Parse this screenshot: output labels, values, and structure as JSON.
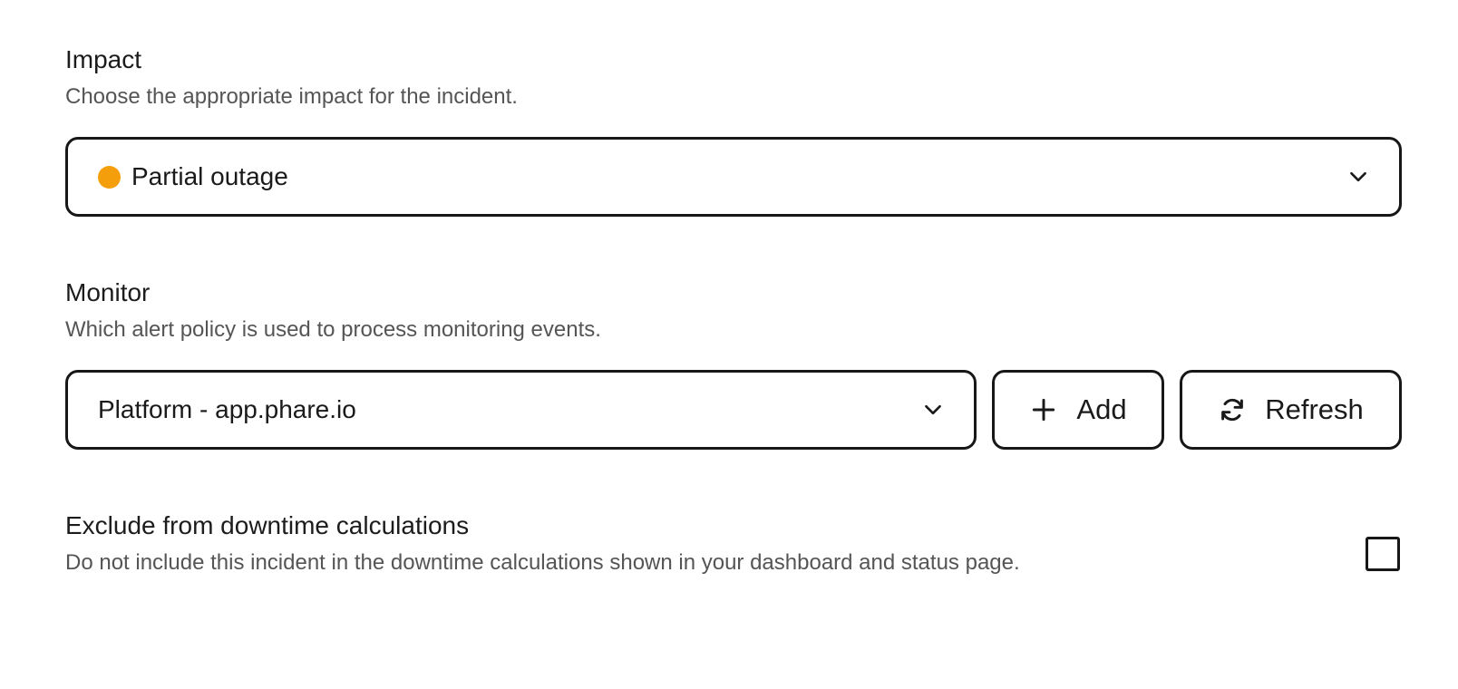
{
  "impact": {
    "title": "Impact",
    "description": "Choose the appropriate impact for the incident.",
    "selected_value": "Partial outage",
    "status_color": "#F59E0B",
    "chevron_icon": "chevron-down-icon"
  },
  "monitor": {
    "title": "Monitor",
    "description": "Which alert policy is used to process monitoring events.",
    "selected_value": "Platform - app.phare.io",
    "chevron_icon": "chevron-down-icon",
    "add_button": {
      "label": "Add",
      "icon": "plus-icon"
    },
    "refresh_button": {
      "label": "Refresh",
      "icon": "refresh-icon"
    }
  },
  "exclude": {
    "title": "Exclude from downtime calculations",
    "description": "Do not include this incident in the downtime calculations shown in your dashboard and status page.",
    "checked": false
  },
  "colors": {
    "border": "#171717",
    "text": "#1a1a1a",
    "muted_text": "#555555",
    "partial_outage": "#F59E0B"
  }
}
